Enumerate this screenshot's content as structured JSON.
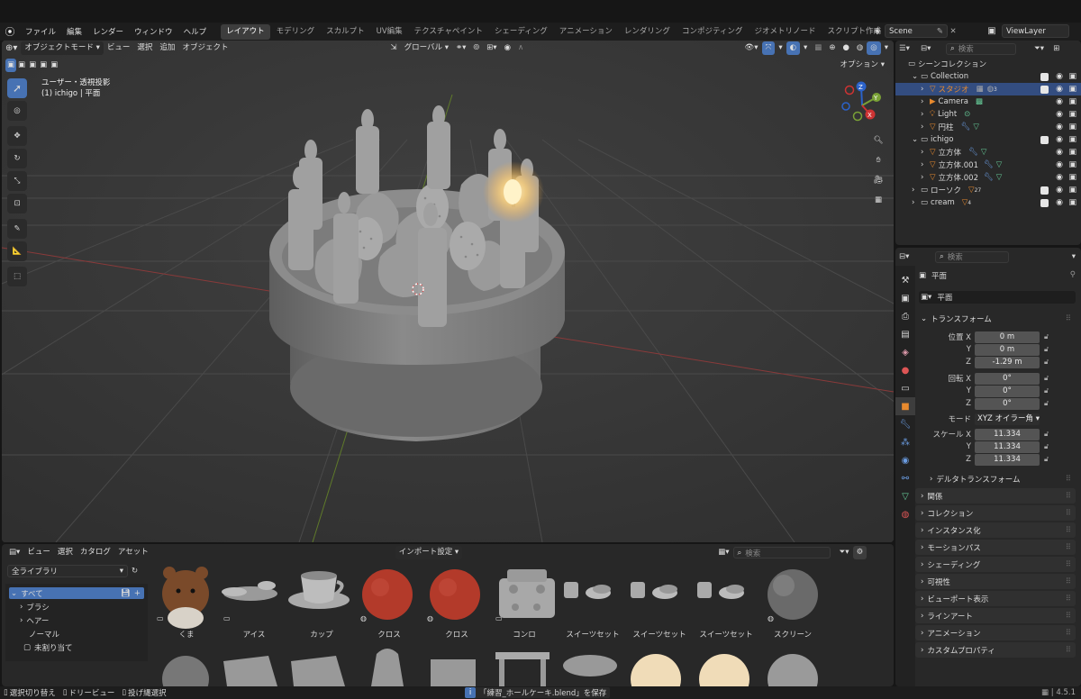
{
  "topbar": {
    "menus": [
      "ファイル",
      "編集",
      "レンダー",
      "ウィンドウ",
      "ヘルプ"
    ],
    "workspace_tabs": [
      "レイアウト",
      "モデリング",
      "スカルプト",
      "UV編集",
      "テクスチャペイント",
      "シェーディング",
      "アニメーション",
      "レンダリング",
      "コンポジティング",
      "ジオメトリノード",
      "スクリプト作成"
    ],
    "add_tab": "+",
    "scene": "Scene",
    "view_layer": "ViewLayer"
  },
  "viewport": {
    "mode": "オブジェクトモード",
    "menus": [
      "ビュー",
      "選択",
      "追加",
      "オブジェクト"
    ],
    "transform_orientation": "グローバル",
    "options": "オプション",
    "info_line1": "ユーザー・透視投影",
    "info_line2": "(1) ichigo | 平面",
    "gizmo": {
      "x": "X",
      "y": "Y",
      "z": "Z"
    }
  },
  "outliner": {
    "search_placeholder": "検索",
    "root": "シーンコレクション",
    "rows": [
      {
        "label": "Collection",
        "level": 1,
        "type": "collection"
      },
      {
        "label": "スタジオ",
        "level": 2,
        "type": "object",
        "selected": true,
        "badge": "3"
      },
      {
        "label": "Camera",
        "level": 2,
        "type": "camera"
      },
      {
        "label": "Light",
        "level": 2,
        "type": "light"
      },
      {
        "label": "円柱",
        "level": 2,
        "type": "mesh"
      },
      {
        "label": "ichigo",
        "level": 1,
        "type": "collection"
      },
      {
        "label": "立方体",
        "level": 2,
        "type": "mesh"
      },
      {
        "label": "立方体.001",
        "level": 2,
        "type": "mesh"
      },
      {
        "label": "立方体.002",
        "level": 2,
        "type": "mesh"
      },
      {
        "label": "ローソク",
        "level": 1,
        "type": "mesh",
        "badge": "27"
      },
      {
        "label": "cream",
        "level": 1,
        "type": "mesh",
        "badge": "4"
      }
    ]
  },
  "properties": {
    "search_placeholder": "検索",
    "object_name": "平面",
    "data_name": "平面",
    "transform_header": "トランスフォーム",
    "location_label": "位置 X",
    "y_label": "Y",
    "z_label": "Z",
    "loc_x": "0 m",
    "loc_y": "0 m",
    "loc_z": "-1.29 m",
    "rotation_label": "回転 X",
    "rot_x": "0°",
    "rot_y": "0°",
    "rot_z": "0°",
    "mode_label": "モード",
    "mode_value": "XYZ オイラー角",
    "scale_label": "スケール X",
    "scale_x": "11.334",
    "scale_y": "11.334",
    "scale_z": "11.334",
    "delta": "デルタトランスフォーム",
    "panels": [
      "関係",
      "コレクション",
      "インスタンス化",
      "モーションパス",
      "シェーディング",
      "可視性",
      "ビューポート表示",
      "ラインアート",
      "アニメーション",
      "カスタムプロパティ"
    ]
  },
  "assets": {
    "menus": [
      "ビュー",
      "選択",
      "カタログ",
      "アセット"
    ],
    "import_setting": "インポート設定",
    "search_placeholder": "検索",
    "library": "全ライブラリ",
    "tree": [
      "すべて",
      "ブラシ",
      "ヘアー",
      "ノーマル",
      "未割り当て"
    ],
    "items": [
      "くま",
      "アイス",
      "カップ",
      "クロス",
      "クロス",
      "コンロ",
      "スイーツセット",
      "スイーツセット",
      "スイーツセット",
      "スクリーン"
    ]
  },
  "status": {
    "left1": "選択切り替え",
    "left2": "ドリービュー",
    "left3": "投げ縄選択",
    "message": "「練習_ホールケーキ.blend」を保存",
    "version": "4.5.1"
  },
  "colors": {
    "accent": "#4772b3",
    "selection": "#334d80",
    "viewport_bg": "#3a3a3a",
    "orange": "#e88a2e"
  }
}
